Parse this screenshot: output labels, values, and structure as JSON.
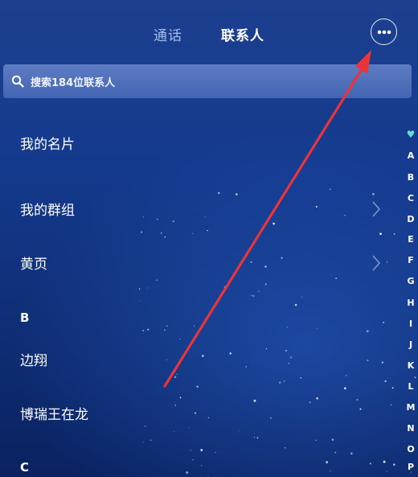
{
  "tabs": {
    "calls": "通话",
    "contacts": "联系人"
  },
  "search": {
    "placeholder": "搜索184位联系人"
  },
  "menu": [
    {
      "label": "我的名片",
      "chevron": false
    },
    {
      "label": "我的群组",
      "chevron": true
    },
    {
      "label": "黄页",
      "chevron": true
    }
  ],
  "sections": [
    {
      "letter": "B",
      "contacts": [
        "边翔",
        "博瑞王在龙"
      ]
    },
    {
      "letter": "C",
      "contacts": []
    }
  ],
  "index": [
    "♥",
    "A",
    "B",
    "C",
    "D",
    "E",
    "F",
    "G",
    "H",
    "I",
    "J",
    "K",
    "L",
    "M",
    "N",
    "O",
    "P"
  ],
  "icons": {
    "more": "more-horizontal-icon",
    "search": "search-icon",
    "chevron": "chevron-right-icon",
    "favorite": "heart-icon"
  },
  "colors": {
    "background": "#143a8e",
    "annotation_arrow": "#e8343a",
    "search_bar": "#8aa6e6"
  }
}
